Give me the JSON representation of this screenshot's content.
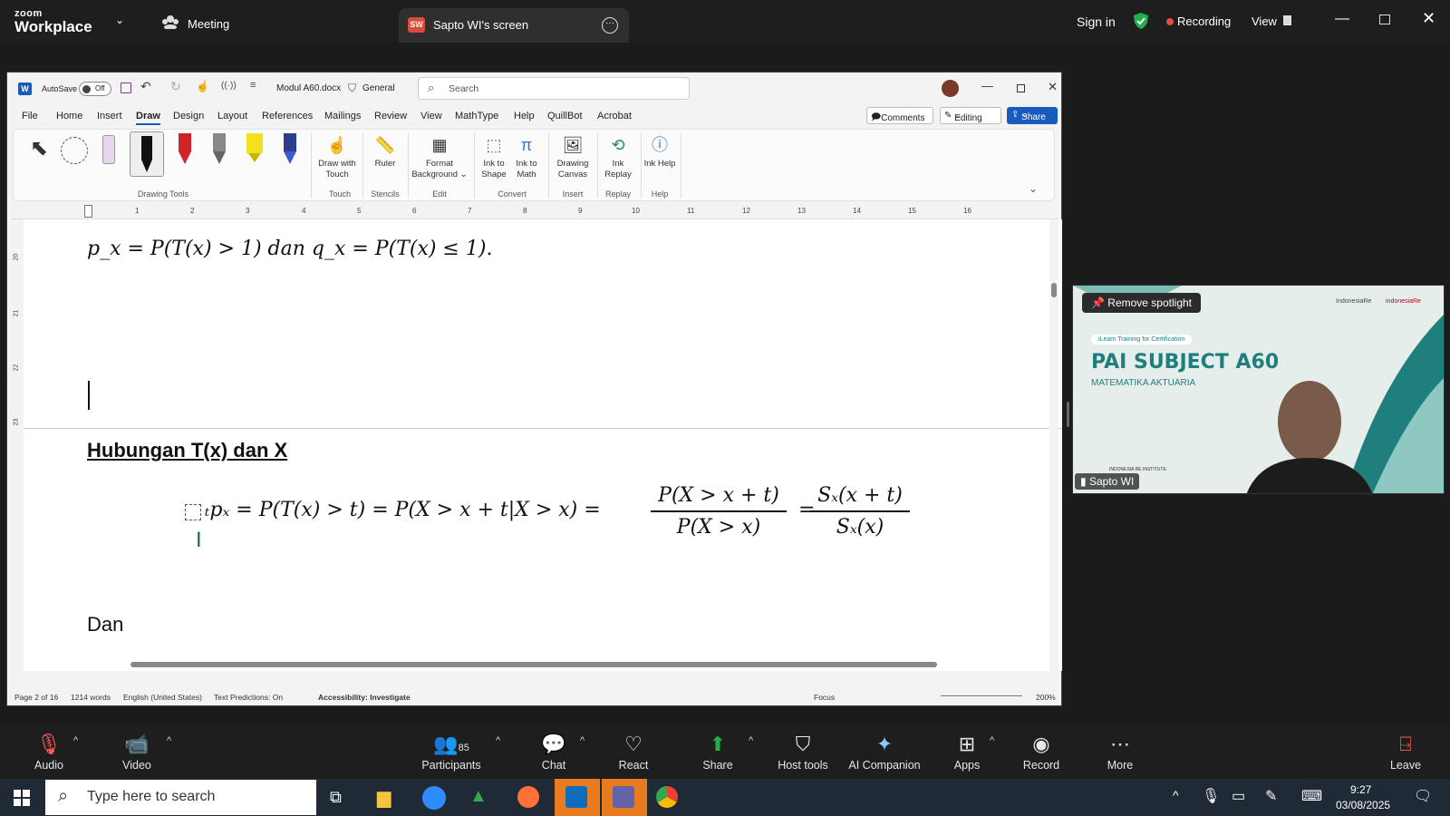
{
  "zoom": {
    "brand_small": "zoom",
    "brand_big": "Workplace",
    "meeting_label": "Meeting",
    "share_tab_initials": "SW",
    "share_tab_label": "Sapto WI's screen",
    "sign_in": "Sign in",
    "recording": "Recording",
    "view": "View"
  },
  "word": {
    "autosave": "AutoSave",
    "autosave_state": "Off",
    "filename": "Modul A60.docx",
    "sensitivity": "General",
    "search_placeholder": "Search",
    "menu": [
      "File",
      "Home",
      "Insert",
      "Draw",
      "Design",
      "Layout",
      "References",
      "Mailings",
      "Review",
      "View",
      "MathType",
      "Help",
      "QuillBot",
      "Acrobat"
    ],
    "comments": "Comments",
    "editing": "Editing",
    "share": "Share",
    "ribbon": {
      "draw_with_touch": "Draw with Touch",
      "ruler": "Ruler",
      "format_background": "Format Background",
      "ink_to_shape": "Ink to Shape",
      "ink_to_math": "Ink to Math",
      "drawing_canvas": "Drawing Canvas",
      "ink_replay": "Ink Replay",
      "ink_help": "Ink Help",
      "groups": [
        "Drawing Tools",
        "Touch",
        "Stencils",
        "Edit",
        "Convert",
        "Insert",
        "Replay",
        "Help"
      ]
    },
    "ruler_numbers": [
      "1",
      "2",
      "3",
      "4",
      "5",
      "6",
      "7",
      "8",
      "9",
      "10",
      "11",
      "12",
      "13",
      "14",
      "15",
      "16"
    ],
    "left_ruler_numbers": [
      "20",
      "21",
      "22",
      "23"
    ],
    "doc": {
      "line1_prefix": "p",
      "line1_full": "p_x = P(T(x) > 1) dan q_x = P(T(x) ≤ 1).",
      "heading": "Hubungan T(x) dan X",
      "eq_main": "ₜpₓ = P(T(x) > t) = P(X > x + t|X > x) =",
      "frac1_num": "P(X > x + t)",
      "frac1_den": "P(X > x)",
      "frac2_num": "Sₓ(x + t)",
      "frac2_den": "Sₓ(x)",
      "dan": "Dan"
    },
    "status": {
      "page": "Page 2 of 16",
      "words": "1214 words",
      "language": "English (United States)",
      "predictions": "Text Predictions: On",
      "accessibility": "Accessibility: Investigate",
      "focus": "Focus",
      "zoom": "200%"
    }
  },
  "video": {
    "remove_spotlight": "Remove spotlight",
    "training": "iLearn Training for Certification",
    "title": "PAI SUBJECT A60",
    "subtitle": "MATEMATIKA AKTUARIA",
    "institute": "INDONESIA RE INSTITUTE",
    "logo1": "IndonesiaRe",
    "logo2": "indonesiaRe",
    "name": "Sapto WI"
  },
  "toolbar": {
    "audio": "Audio",
    "video": "Video",
    "participants": "Participants",
    "participants_count": "85",
    "chat": "Chat",
    "react": "React",
    "share": "Share",
    "host_tools": "Host tools",
    "ai_companion": "AI Companion",
    "apps": "Apps",
    "record": "Record",
    "more": "More",
    "leave": "Leave"
  },
  "taskbar": {
    "search_placeholder": "Type here to search",
    "time": "9:27",
    "date": "03/08/2025"
  },
  "colors": {
    "recording_dot": "#e64a4a",
    "shield": "#1fb04c",
    "share_green": "#1fb04c",
    "word_blue": "#185abd",
    "pai_teal": "#1f7f7d"
  }
}
